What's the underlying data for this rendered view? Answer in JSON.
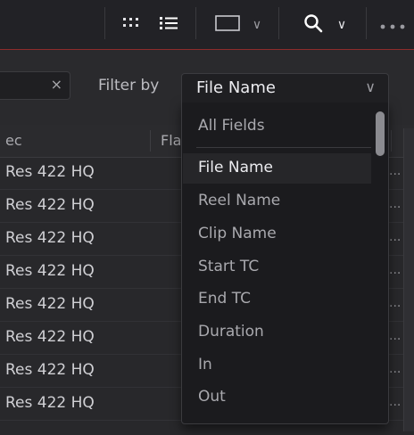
{
  "toolbar": {
    "grid_icon": "grid-view-icon",
    "list_icon": "list-view-icon",
    "frame_icon": "frame-size-icon",
    "search_icon": "search-icon",
    "more_icon": "more-options-icon",
    "accent_color": "#8e2b2b"
  },
  "filter": {
    "clear_glyph": "×",
    "label": "Filter by",
    "selected": "File Name",
    "options": [
      {
        "label": "All Fields"
      },
      {
        "label": "File Name"
      },
      {
        "label": "Reel Name"
      },
      {
        "label": "Clip Name"
      },
      {
        "label": "Start TC"
      },
      {
        "label": "End TC"
      },
      {
        "label": "Duration"
      },
      {
        "label": "In"
      },
      {
        "label": "Out"
      }
    ]
  },
  "table": {
    "headers": {
      "codec": "ec",
      "flags": "Fla"
    },
    "rows": [
      {
        "codec": "Res 422 HQ",
        "more": "..."
      },
      {
        "codec": "Res 422 HQ",
        "more": "..."
      },
      {
        "codec": "Res 422 HQ",
        "more": "..."
      },
      {
        "codec": "Res 422 HQ",
        "more": "..."
      },
      {
        "codec": "Res 422 HQ",
        "more": "..."
      },
      {
        "codec": "Res 422 HQ",
        "more": "..."
      },
      {
        "codec": "Res 422 HQ",
        "more": "..."
      },
      {
        "codec": "Res 422 HQ",
        "more": "..."
      }
    ]
  }
}
